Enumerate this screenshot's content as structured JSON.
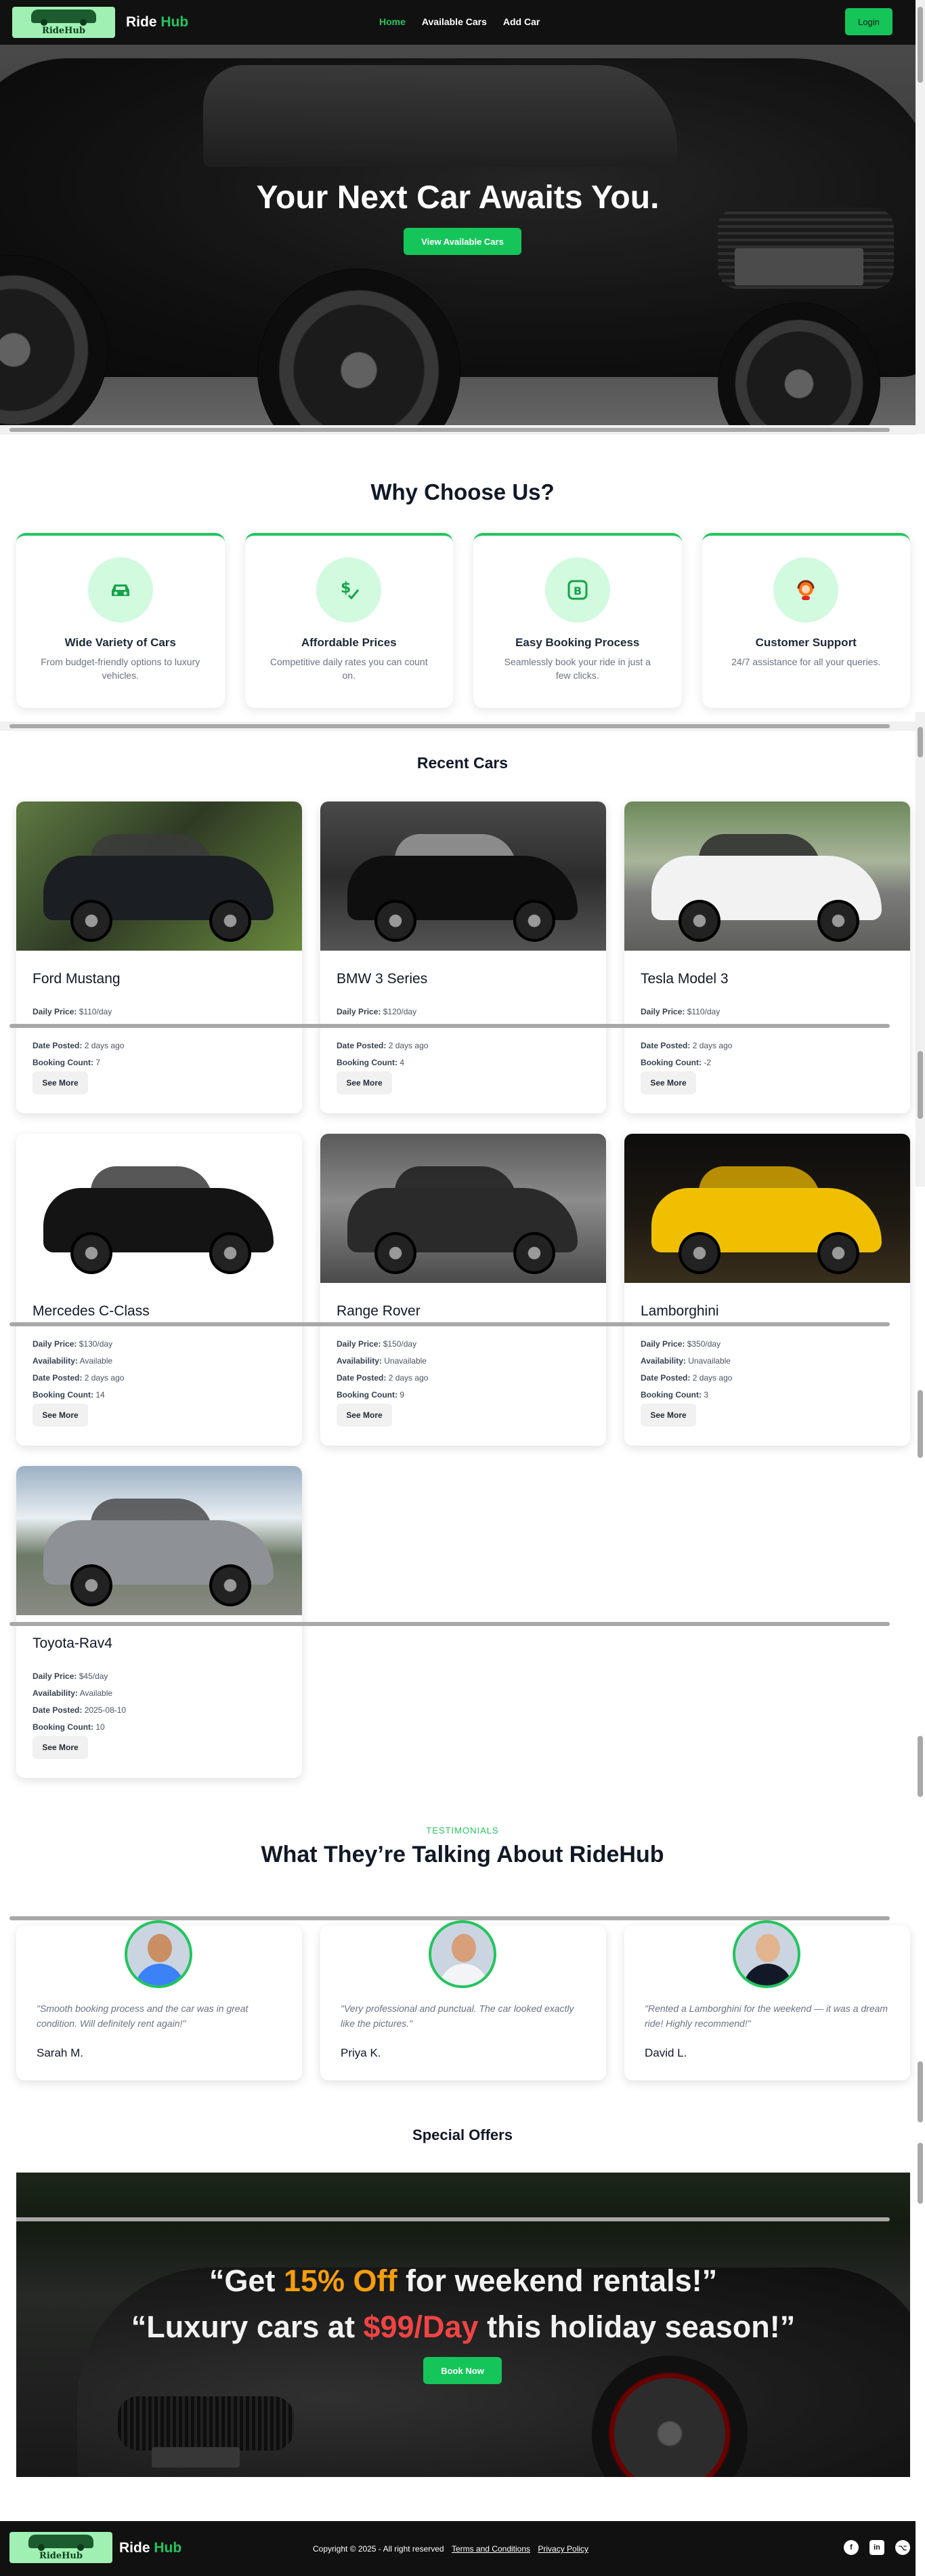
{
  "nav": {
    "logo_text": "RideHub",
    "brand_main": "Ride",
    "brand_accent": "Hub",
    "links": [
      "Home",
      "Available Cars",
      "Add Car"
    ],
    "login_label": "Login"
  },
  "hero": {
    "title": "Your Next Car Awaits You.",
    "cta": "View Available Cars"
  },
  "why": {
    "title": "Why Choose Us?",
    "features": [
      {
        "title": "Wide Variety of Cars",
        "text": "From budget-friendly options to luxury vehicles.",
        "icon": "car-icon"
      },
      {
        "title": "Affordable Prices",
        "text": "Competitive daily rates you can count on.",
        "icon": "price-tag-icon"
      },
      {
        "title": "Easy Booking Process",
        "text": "Seamlessly book your ride in just a few clicks.",
        "icon": "booking-icon"
      },
      {
        "title": "Customer Support",
        "text": "24/7 assistance for all your queries.",
        "icon": "support-agent-icon"
      }
    ]
  },
  "recent": {
    "title": "Recent Cars",
    "labels": {
      "price": "Daily Price:",
      "availability": "Availability:",
      "date": "Date Posted:",
      "count": "Booking Count:",
      "see_more": "See More"
    },
    "cars": [
      {
        "name": "Ford Mustang",
        "price": "$110/day",
        "availability": "",
        "date": "2 days ago",
        "count": "7"
      },
      {
        "name": "BMW 3 Series",
        "price": "$120/day",
        "availability": "",
        "date": "2 days ago",
        "count": "4"
      },
      {
        "name": "Tesla Model 3",
        "price": "$110/day",
        "availability": "",
        "date": "2 days ago",
        "count": "-2"
      },
      {
        "name": "Mercedes C-Class",
        "price": "$130/day",
        "availability": "Available",
        "date": "2 days ago",
        "count": "14"
      },
      {
        "name": "Range Rover",
        "price": "$150/day",
        "availability": "Unavailable",
        "date": "2 days ago",
        "count": "9"
      },
      {
        "name": "Lamborghini",
        "price": "$350/day",
        "availability": "Unavailable",
        "date": "2 days ago",
        "count": "3"
      },
      {
        "name": "Toyota-Rav4",
        "price": "$45/day",
        "availability": "Available",
        "date": "2025-08-10",
        "count": "10"
      }
    ]
  },
  "testimonials": {
    "kicker": "TESTIMONIALS",
    "title": "What They’re Talking About RideHub",
    "items": [
      {
        "quote": "\"Smooth booking process and the car was in great condition. Will definitely rent again!\"",
        "name": "Sarah M."
      },
      {
        "quote": "\"Very professional and punctual. The car looked exactly like the pictures.\"",
        "name": "Priya K."
      },
      {
        "quote": "\"Rented a Lamborghini for the weekend — it was a dream ride! Highly recommend!\"",
        "name": "David L."
      }
    ]
  },
  "offers": {
    "title": "Special Offers",
    "line1_pre": "“Get ",
    "line1_hl": "15% Off",
    "line1_post": " for weekend rentals!”",
    "line2_pre": "“Luxury cars at ",
    "line2_hl": "$99/Day",
    "line2_post": " this holiday season!”",
    "cta": "Book Now"
  },
  "footer": {
    "logo_text": "RideHub",
    "brand_main": "Ride",
    "brand_accent": "Hub",
    "copyright": "Copyright © 2025 - All right reserved",
    "terms": "Terms and Conditions",
    "privacy": "Privacy Policy",
    "socials": [
      "facebook-icon",
      "linkedin-icon",
      "github-icon"
    ]
  },
  "colors": {
    "accent": "#22c55e",
    "nav_bg": "#111111",
    "offer_orange": "#f59e0b",
    "offer_red": "#ef4444"
  }
}
